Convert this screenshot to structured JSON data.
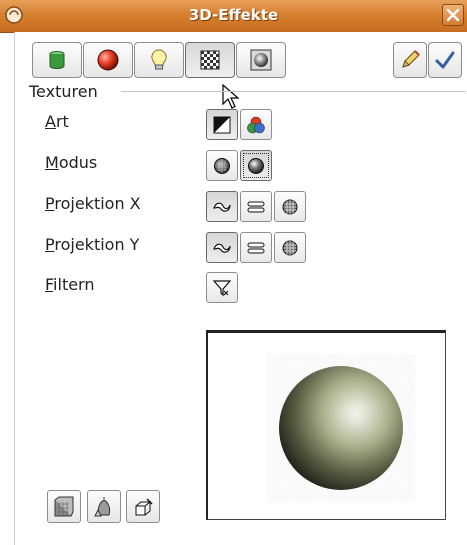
{
  "window": {
    "title": "3D-Effekte"
  },
  "colors": {
    "titlebar": "#d57f2f",
    "accent_red": "#c0392b",
    "green": "#3b9a3b"
  },
  "toolbar": {
    "buttons": [
      {
        "name": "geometry",
        "icon": "green-cylinder-icon"
      },
      {
        "name": "shading",
        "icon": "red-sphere-icon"
      },
      {
        "name": "illumination",
        "icon": "lightbulb-icon"
      },
      {
        "name": "textures",
        "icon": "checker-texture-icon",
        "pressed": true
      },
      {
        "name": "material",
        "icon": "material-sphere-icon"
      }
    ],
    "right_buttons": [
      {
        "name": "assign",
        "icon": "pencil-icon"
      },
      {
        "name": "apply",
        "icon": "checkmark-icon"
      }
    ]
  },
  "section": {
    "title": "Texturen"
  },
  "rows": [
    {
      "key": "art",
      "label": "Art",
      "mnemonic": "A",
      "rest": "rt"
    },
    {
      "key": "modus",
      "label": "Modus",
      "mnemonic": "M",
      "rest": "odus"
    },
    {
      "key": "projx",
      "label": "Projektion X",
      "mnemonic": "P",
      "rest": "rojektion X"
    },
    {
      "key": "projy",
      "label": "Projektion Y",
      "mnemonic": "P",
      "rest": "rojektion Y"
    },
    {
      "key": "filter",
      "label": "Filtern",
      "mnemonic": "F",
      "rest": "iltern"
    }
  ],
  "bottom_buttons": [
    {
      "name": "convert-to-3d",
      "icon": "cube-convert-icon"
    },
    {
      "name": "perspective",
      "icon": "perspective-icon"
    },
    {
      "name": "convert-to-rotation",
      "icon": "rotation-object-icon"
    }
  ]
}
